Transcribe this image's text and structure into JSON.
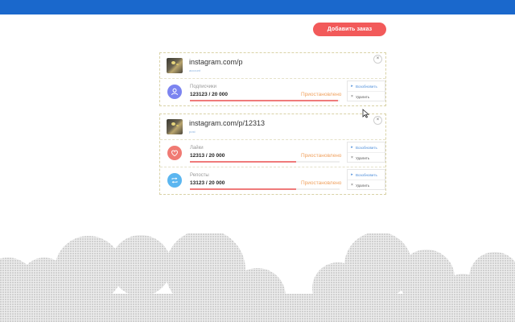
{
  "header": {
    "add_order_label": "Добавить заказ",
    "accent": "#1a68cc",
    "button_color": "#f25a5a"
  },
  "orders": [
    {
      "url": "instagram.com/p",
      "type_label": "account",
      "close_glyph": "×",
      "services": [
        {
          "icon": "user-icon",
          "icon_color": "#7c84f0",
          "label": "Подписчики",
          "count": "123123 / 20 000",
          "status": "Приостановлено",
          "progress": 0.99,
          "resume_label": "Возобновить",
          "delete_label": "Удалить"
        }
      ]
    },
    {
      "url": "instagram.com/p/12313",
      "type_label": "post",
      "close_glyph": "×",
      "services": [
        {
          "icon": "heart-icon",
          "icon_color": "#f07a73",
          "label": "Лайки",
          "count": "12313 / 20 000",
          "status": "Приостановлено",
          "progress": 0.71,
          "resume_label": "Возобновить",
          "delete_label": "Удалить"
        },
        {
          "icon": "repost-icon",
          "icon_color": "#5bb6f0",
          "label": "Репосты",
          "count": "13123 / 20 000",
          "status": "Приостановлено",
          "progress": 0.71,
          "resume_label": "Возобновить",
          "delete_label": "Удалить"
        }
      ]
    }
  ]
}
